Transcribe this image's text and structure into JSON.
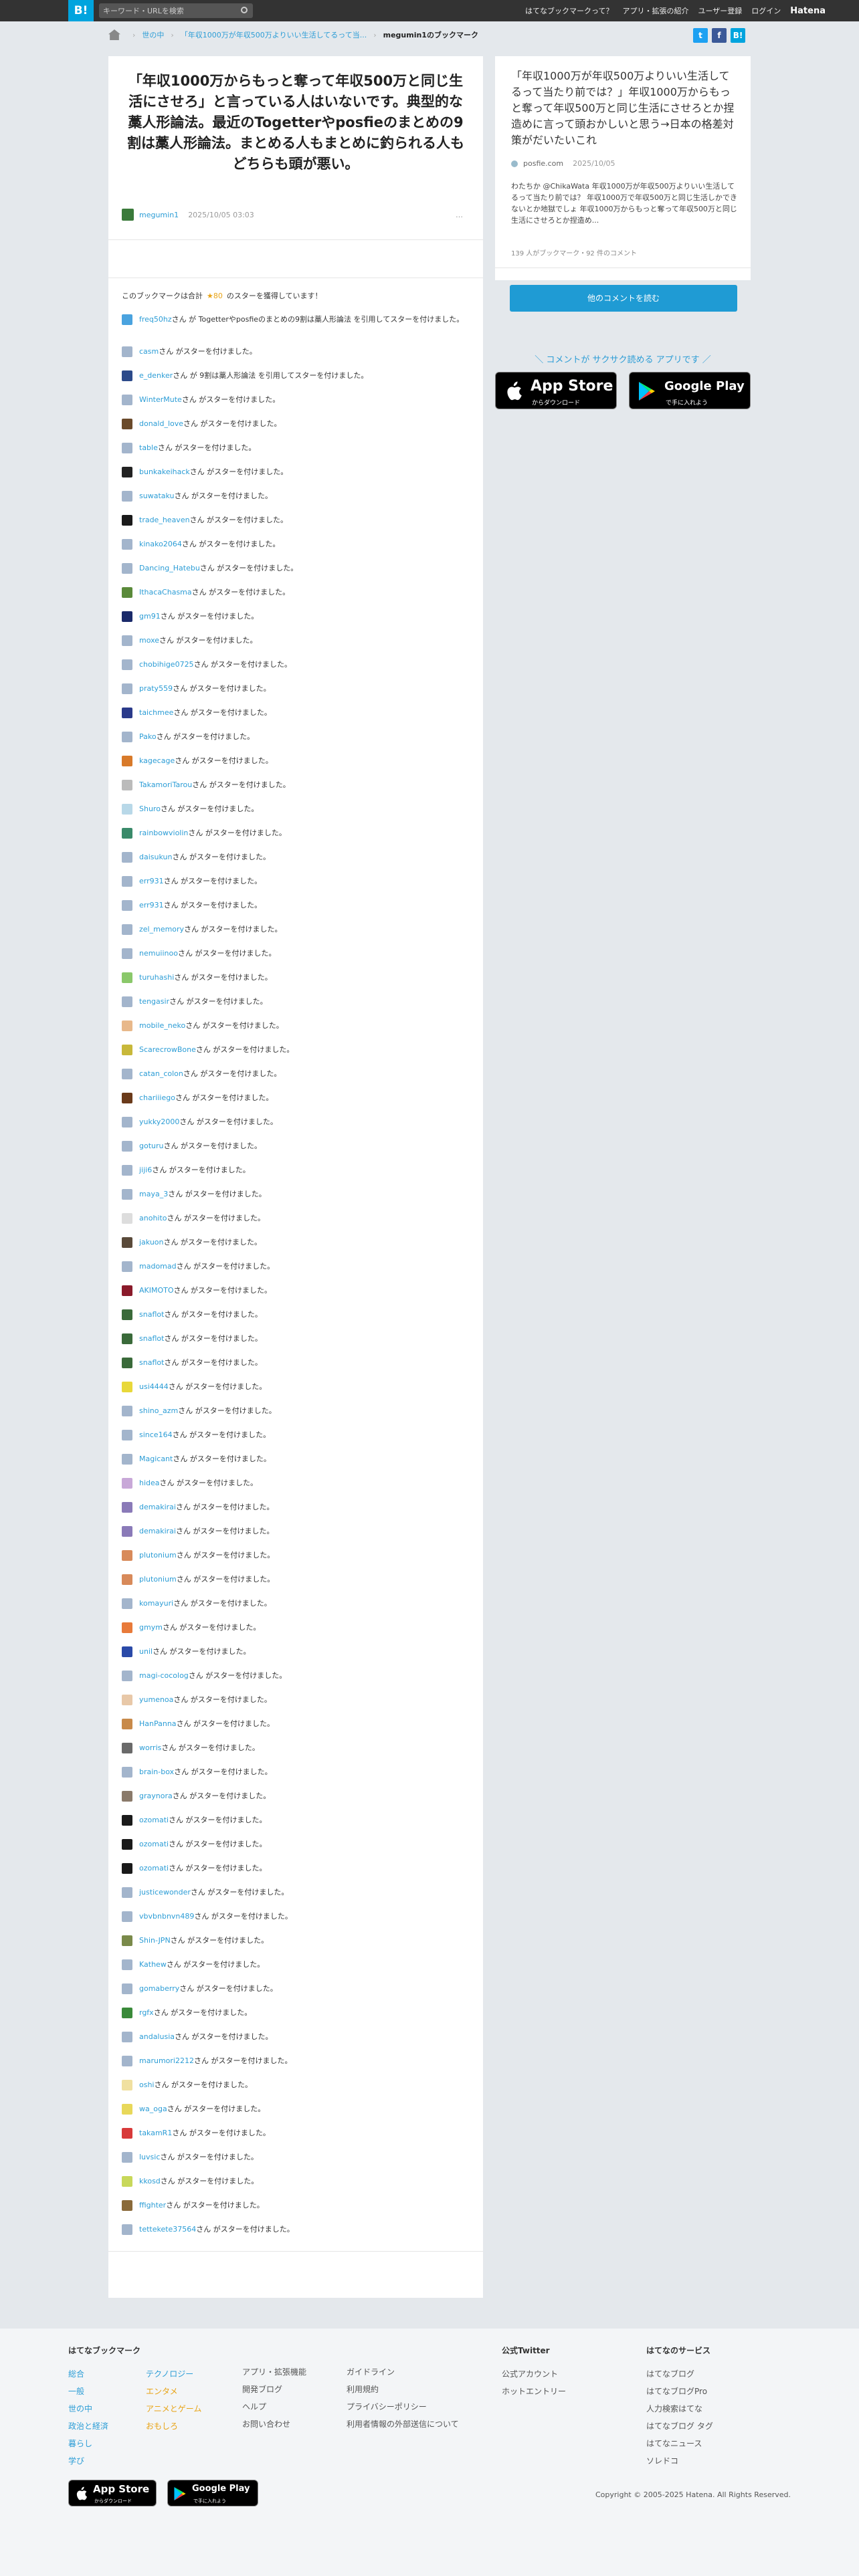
{
  "header": {
    "logo": "B!",
    "search_placeholder": "キーワード・URLを検索",
    "nav": [
      "はてなブックマークって？",
      "アプリ・拡張の紹介",
      "ユーザー登録",
      "ログイン",
      "Hatena"
    ]
  },
  "breadcrumb": {
    "items": [
      "世の中",
      "「年収1000万が年収500万よりいい生活してるって当..."
    ],
    "current": "megumin1のブックマーク"
  },
  "share": [
    "t",
    "f",
    "B!"
  ],
  "entry": {
    "title": "「年収1000万からもっと奪って年収500万と同じ生活にさせろ」と言っている人はいないです。典型的な藁人形論法。最近のTogetterやposfieのまとめの9割は藁人形論法。まとめる人もまとめに釣られる人もどちらも頭が悪い。",
    "user": "megumin1",
    "date": "2025/10/05 03:03",
    "more": "…"
  },
  "stars": {
    "prefix": "このブックマークは合計",
    "count": "★80",
    "suffix": "のスターを獲得しています！"
  },
  "list": [
    {
      "user": "freq50hz",
      "text": "さん が Togetterやposfieのまとめの9割は藁人形論法 を引用してスターを付けました。",
      "color": "#4aa3df",
      "tall": true
    },
    {
      "user": "casm",
      "text": "さん がスターを付けました。",
      "color": "#a3b5cc"
    },
    {
      "user": "e_denker",
      "text": "さん が 9割は藁人形論法 を引用してスターを付けました。",
      "color": "#2c4a8a"
    },
    {
      "user": "WinterMute",
      "text": "さん がスターを付けました。",
      "color": "#a3b5cc"
    },
    {
      "user": "donald_love",
      "text": "さん がスターを付けました。",
      "color": "#6a4a2a"
    },
    {
      "user": "table",
      "text": "さん がスターを付けました。",
      "color": "#a3b5cc"
    },
    {
      "user": "bunkakeihack",
      "text": "さん がスターを付けました。",
      "color": "#222"
    },
    {
      "user": "suwataku",
      "text": "さん がスターを付けました。",
      "color": "#a3b5cc"
    },
    {
      "user": "trade_heaven",
      "text": "さん がスターを付けました。",
      "color": "#1a1a1a"
    },
    {
      "user": "kinako2064",
      "text": "さん がスターを付けました。",
      "color": "#a3b5cc"
    },
    {
      "user": "Dancing_Hatebu",
      "text": "さん がスターを付けました。",
      "color": "#a3b5cc"
    },
    {
      "user": "IthacaChasma",
      "text": "さん がスターを付けました。",
      "color": "#5a8a3a"
    },
    {
      "user": "gm91",
      "text": "さん がスターを付けました。",
      "color": "#1a2a6a"
    },
    {
      "user": "moxe",
      "text": "さん がスターを付けました。",
      "color": "#a3b5cc"
    },
    {
      "user": "chobihige0725",
      "text": "さん がスターを付けました。",
      "color": "#a3b5cc"
    },
    {
      "user": "praty559",
      "text": "さん がスターを付けました。",
      "color": "#a3b5cc"
    },
    {
      "user": "taichmee",
      "text": "さん がスターを付けました。",
      "color": "#2a3a8a"
    },
    {
      "user": "Pako",
      "text": "さん がスターを付けました。",
      "color": "#a3b5cc"
    },
    {
      "user": "kagecage",
      "text": "さん がスターを付けました。",
      "color": "#d87a2a"
    },
    {
      "user": "TakamoriTarou",
      "text": "さん がスターを付けました。",
      "color": "#bbb"
    },
    {
      "user": "Shuro",
      "text": "さん がスターを付けました。",
      "color": "#b8d8e8"
    },
    {
      "user": "rainbowviolin",
      "text": "さん がスターを付けました。",
      "color": "#3a8a6a"
    },
    {
      "user": "daisukun",
      "text": "さん がスターを付けました。",
      "color": "#a3b5cc"
    },
    {
      "user": "err931",
      "text": "さん がスターを付けました。",
      "color": "#a3b5cc"
    },
    {
      "user": "err931",
      "text": "さん がスターを付けました。",
      "color": "#a3b5cc"
    },
    {
      "user": "zel_memory",
      "text": "さん がスターを付けました。",
      "color": "#a3b5cc"
    },
    {
      "user": "nemuiinoo",
      "text": "さん がスターを付けました。",
      "color": "#a3b5cc"
    },
    {
      "user": "turuhashi",
      "text": "さん がスターを付けました。",
      "color": "#8ac86a"
    },
    {
      "user": "tengasir",
      "text": "さん がスターを付けました。",
      "color": "#a3b5cc"
    },
    {
      "user": "mobile_neko",
      "text": "さん がスターを付けました。",
      "color": "#e8b88a"
    },
    {
      "user": "ScarecrowBone",
      "text": "さん がスターを付けました。",
      "color": "#c8b83a"
    },
    {
      "user": "catan_colon",
      "text": "さん がスターを付けました。",
      "color": "#a3b5cc"
    },
    {
      "user": "chariiiego",
      "text": "さん がスターを付けました。",
      "color": "#6a3a1a"
    },
    {
      "user": "yukky2000",
      "text": "さん がスターを付けました。",
      "color": "#a3b5cc"
    },
    {
      "user": "goturu",
      "text": "さん がスターを付けました。",
      "color": "#a3b5cc"
    },
    {
      "user": "jiji6",
      "text": "さん がスターを付けました。",
      "color": "#a3b5cc"
    },
    {
      "user": "maya_3",
      "text": "さん がスターを付けました。",
      "color": "#a3b5cc"
    },
    {
      "user": "anohito",
      "text": "さん がスターを付けました。",
      "color": "#ddd"
    },
    {
      "user": "jakuon",
      "text": "さん がスターを付けました。",
      "color": "#5a4a3a"
    },
    {
      "user": "madomad",
      "text": "さん がスターを付けました。",
      "color": "#a3b5cc"
    },
    {
      "user": "AKIMOTO",
      "text": "さん がスターを付けました。",
      "color": "#8a1a2a"
    },
    {
      "user": "snaflot",
      "text": "さん がスターを付けました。",
      "color": "#3a6a3a"
    },
    {
      "user": "snaflot",
      "text": "さん がスターを付けました。",
      "color": "#3a6a3a"
    },
    {
      "user": "snaflot",
      "text": "さん がスターを付けました。",
      "color": "#3a6a3a"
    },
    {
      "user": "usi4444",
      "text": "さん がスターを付けました。",
      "color": "#e8d83a"
    },
    {
      "user": "shino_azm",
      "text": "さん がスターを付けました。",
      "color": "#a3b5cc"
    },
    {
      "user": "since164",
      "text": "さん がスターを付けました。",
      "color": "#a3b5cc"
    },
    {
      "user": "Magicant",
      "text": "さん がスターを付けました。",
      "color": "#a3b5cc"
    },
    {
      "user": "hidea",
      "text": "さん がスターを付けました。",
      "color": "#c8a8d8"
    },
    {
      "user": "demakirai",
      "text": "さん がスターを付けました。",
      "color": "#8a7ab8"
    },
    {
      "user": "demakirai",
      "text": "さん がスターを付けました。",
      "color": "#8a7ab8"
    },
    {
      "user": "plutonium",
      "text": "さん がスターを付けました。",
      "color": "#d88a5a"
    },
    {
      "user": "plutonium",
      "text": "さん がスターを付けました。",
      "color": "#d88a5a"
    },
    {
      "user": "komayuri",
      "text": "さん がスターを付けました。",
      "color": "#a3b5cc"
    },
    {
      "user": "gmym",
      "text": "さん がスターを付けました。",
      "color": "#e87a3a"
    },
    {
      "user": "unil",
      "text": "さん がスターを付けました。",
      "color": "#2a4aa8"
    },
    {
      "user": "magi-cocolog",
      "text": "さん がスターを付けました。",
      "color": "#a3b5cc"
    },
    {
      "user": "yumenoa",
      "text": "さん がスターを付けました。",
      "color": "#e8c8a8"
    },
    {
      "user": "HanPanna",
      "text": "さん がスターを付けました。",
      "color": "#c88a4a"
    },
    {
      "user": "worris",
      "text": "さん がスターを付けました。",
      "color": "#6a6a6a"
    },
    {
      "user": "brain-box",
      "text": "さん がスターを付けました。",
      "color": "#a3b5cc"
    },
    {
      "user": "graynora",
      "text": "さん がスターを付けました。",
      "color": "#8a7a6a"
    },
    {
      "user": "ozomati",
      "text": "さん がスターを付けました。",
      "color": "#1a1a1a"
    },
    {
      "user": "ozomati",
      "text": "さん がスターを付けました。",
      "color": "#1a1a1a"
    },
    {
      "user": "ozomati",
      "text": "さん がスターを付けました。",
      "color": "#1a1a1a"
    },
    {
      "user": "justicewonder",
      "text": "さん がスターを付けました。",
      "color": "#a3b5cc"
    },
    {
      "user": "vbvbnbnvn489",
      "text": "さん がスターを付けました。",
      "color": "#a3b5cc"
    },
    {
      "user": "Shin-JPN",
      "text": "さん がスターを付けました。",
      "color": "#7a8a4a"
    },
    {
      "user": "Kathew",
      "text": "さん がスターを付けました。",
      "color": "#a3b5cc"
    },
    {
      "user": "gomaberry",
      "text": "さん がスターを付けました。",
      "color": "#a3b5cc"
    },
    {
      "user": "rgfx",
      "text": "さん がスターを付けました。",
      "color": "#3a8a3a"
    },
    {
      "user": "andalusia",
      "text": "さん がスターを付けました。",
      "color": "#a3b5cc"
    },
    {
      "user": "marumori2212",
      "text": "さん がスターを付けました。",
      "color": "#a3b5cc"
    },
    {
      "user": "oshi",
      "text": "さん がスターを付けました。",
      "color": "#f0e0a0"
    },
    {
      "user": "wa_oga",
      "text": "さん がスターを付けました。",
      "color": "#e8d85a"
    },
    {
      "user": "takamR1",
      "text": "さん がスターを付けました。",
      "color": "#d83a3a"
    },
    {
      "user": "luvsic",
      "text": "さん がスターを付けました。",
      "color": "#a3b5cc"
    },
    {
      "user": "kkosd",
      "text": "さん がスターを付けました。",
      "color": "#c8d85a"
    },
    {
      "user": "ffighter",
      "text": "さん がスターを付けました。",
      "color": "#8a6a3a"
    },
    {
      "user": "tettekete37564",
      "text": "さん がスターを付けました。",
      "color": "#a3b5cc"
    }
  ],
  "side": {
    "title": "「年収1000万が年収500万よりいい生活してるって当たり前では？」年収1000万からもっと奪って年収500万と同じ生活にさせろとか捏造めに言って頭おかしいと思う→日本の格差対策がだいたいこれ",
    "source": "posfie.com",
    "date": "2025/10/05",
    "desc": "わたちか @ChikaWata 年収1000万が年収500万よりいい生活してるって当たり前では？ 年収1000万で年収500万と同じ生活しかできないとか地獄でしょ 年収1000万からもっと奪って年収500万と同じ生活にさせろとか捏造め...",
    "counts": "139 人がブックマーク・92 件のコメント",
    "readmore": "他のコメントを読む"
  },
  "app_promo": {
    "tagline": "＼ コメントが サクサク読める アプリです ／",
    "appstore": {
      "main": "App Store",
      "sub": "からダウンロード"
    },
    "googleplay": {
      "main": "Google Play",
      "sub": "で手に入れよう"
    }
  },
  "footer": {
    "col1": {
      "heading": "はてなブックマーク",
      "cats_a": [
        "総合",
        "一般",
        "世の中",
        "政治と経済",
        "暮らし",
        "学び"
      ],
      "cats_b": [
        "テクノロジー",
        "エンタメ",
        "アニメとゲーム",
        "おもしろ"
      ]
    },
    "col2": [
      "アプリ・拡張機能",
      "開発ブログ",
      "ヘルプ",
      "お問い合わせ"
    ],
    "col3": [
      "ガイドライン",
      "利用規約",
      "プライバシーポリシー",
      "利用者情報の外部送信について"
    ],
    "col4": {
      "heading": "公式Twitter",
      "items": [
        "公式アカウント",
        "ホットエントリー"
      ]
    },
    "col5": {
      "heading": "はてなのサービス",
      "items": [
        "はてなブログ",
        "はてなブログPro",
        "人力検索はてな",
        "はてなブログ タグ",
        "はてなニュース",
        "ソレドコ"
      ]
    },
    "appstore": {
      "main": "App Store",
      "sub": "からダウンロード"
    },
    "googleplay": {
      "main": "Google Play",
      "sub": "で手に入れよう"
    },
    "copyright": "Copyright © 2005-2025 Hatena. All Rights Reserved."
  }
}
